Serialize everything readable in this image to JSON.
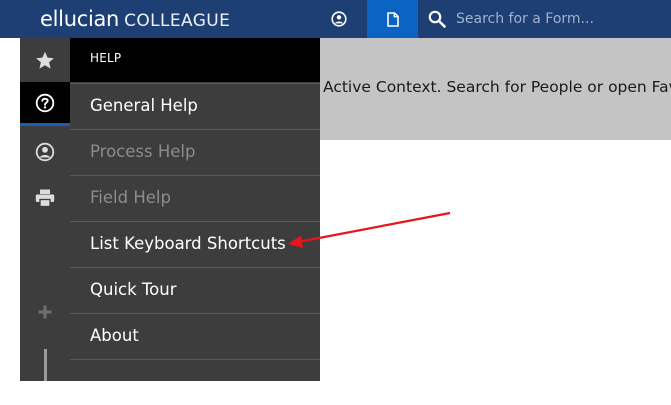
{
  "header": {
    "brand_main": "ellucian",
    "brand_sub": "COLLEAGUE",
    "search_placeholder": "Search for a Form..."
  },
  "help_menu": {
    "title": "HELP",
    "items": [
      {
        "label": "General Help",
        "enabled": true
      },
      {
        "label": "Process Help",
        "enabled": false
      },
      {
        "label": "Field Help",
        "enabled": false
      },
      {
        "label": "List Keyboard Shortcuts",
        "enabled": true
      },
      {
        "label": "Quick Tour",
        "enabled": true
      },
      {
        "label": "About",
        "enabled": true
      }
    ]
  },
  "content": {
    "message": "Active Context. Search for People or open Favo"
  },
  "colors": {
    "header_bg": "#1d3f73",
    "active_tab": "#0b63c3",
    "annotation_arrow": "#e8151b"
  },
  "icons": [
    "user-circle-icon",
    "document-icon",
    "search-icon",
    "star-icon",
    "help-circle-icon",
    "user-icon",
    "printer-icon",
    "plus-icon"
  ]
}
